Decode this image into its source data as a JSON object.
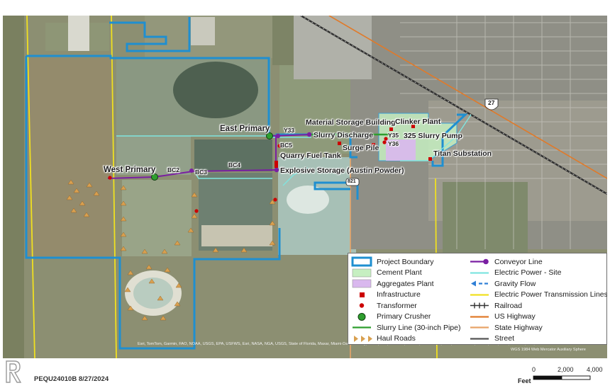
{
  "map": {
    "labels": {
      "east_primary": "East Primary",
      "west_primary": "West Primary",
      "y33": "Y33",
      "slurry_discharge": "Slurry Discharge",
      "material_storage": "Material Storage Building",
      "clinker_plant": "Clinker Plant",
      "y35": "Y35",
      "y36": "Y36",
      "slurry_pump": "325 Slurry Pump",
      "surge_pile": "Surge Pile",
      "bc5": "BC5",
      "quarry_fuel_tank": "Quarry Fuel Tank",
      "titan_substation": "Titan Substation",
      "explosive_storage": "Explosive Storage (Austin Powder)",
      "bc2": "BC2",
      "bc3": "BC3",
      "bc4": "BC4",
      "us27": "27",
      "sr821": "821"
    },
    "credits": "Esri, TomTom, Garmin, FAO, NOAA, USGS, EPA, USFWS, Esri, NASA, NGA, USGS, State of Florida, Maxar, Miami-Dade County, FDEP, Esri, TomTom, Garmin, SafeGraph, FAO, METI/NASA, USGS, EPA, NPS, USFWS, Esri, USGS",
    "projection": "WGS 1984 Web Mercator Auxiliary Sphere"
  },
  "legend": {
    "col1": [
      {
        "label": "Project Boundary",
        "symbol": "boundary",
        "color": "#1f8fd0"
      },
      {
        "label": "Cement Plant",
        "symbol": "fill",
        "color": "#c6efc1"
      },
      {
        "label": "Aggregates Plant",
        "symbol": "fill",
        "color": "#d9b8ee"
      },
      {
        "label": "Infrastructure",
        "symbol": "square",
        "color": "#cc0000"
      },
      {
        "label": "Transformer",
        "symbol": "dot",
        "color": "#cc0000"
      },
      {
        "label": "Primary Crusher",
        "symbol": "circle",
        "color": "#2e9e2e"
      },
      {
        "label": "Slurry Line (30-inch Pipe)",
        "symbol": "line",
        "color": "#2e9e2e"
      },
      {
        "label": "Haul Roads",
        "symbol": "triangles",
        "color": "#d9a050"
      }
    ],
    "col2": [
      {
        "label": "Conveyor Line",
        "symbol": "conveyor",
        "color": "#7a1fa2"
      },
      {
        "label": "Electric Power - Site",
        "symbol": "line",
        "color": "#7fe5e0"
      },
      {
        "label": "Gravity Flow",
        "symbol": "dashed",
        "color": "#2f7fd6"
      },
      {
        "label": "Electric Power Transmission Lines",
        "symbol": "line",
        "color": "#f0e020"
      },
      {
        "label": "Railroad",
        "symbol": "railroad",
        "color": "#333333"
      },
      {
        "label": "US Highway",
        "symbol": "line",
        "color": "#e07a2a"
      },
      {
        "label": "State Highway",
        "symbol": "line",
        "color": "#e8a468"
      },
      {
        "label": "Street",
        "symbol": "line",
        "color": "#555555"
      }
    ]
  },
  "footer": {
    "doc_id": "PEQU24010B 8/27/2024",
    "scale_ticks": [
      "0",
      "2,000",
      "4,000"
    ],
    "scale_units": "Feet"
  }
}
